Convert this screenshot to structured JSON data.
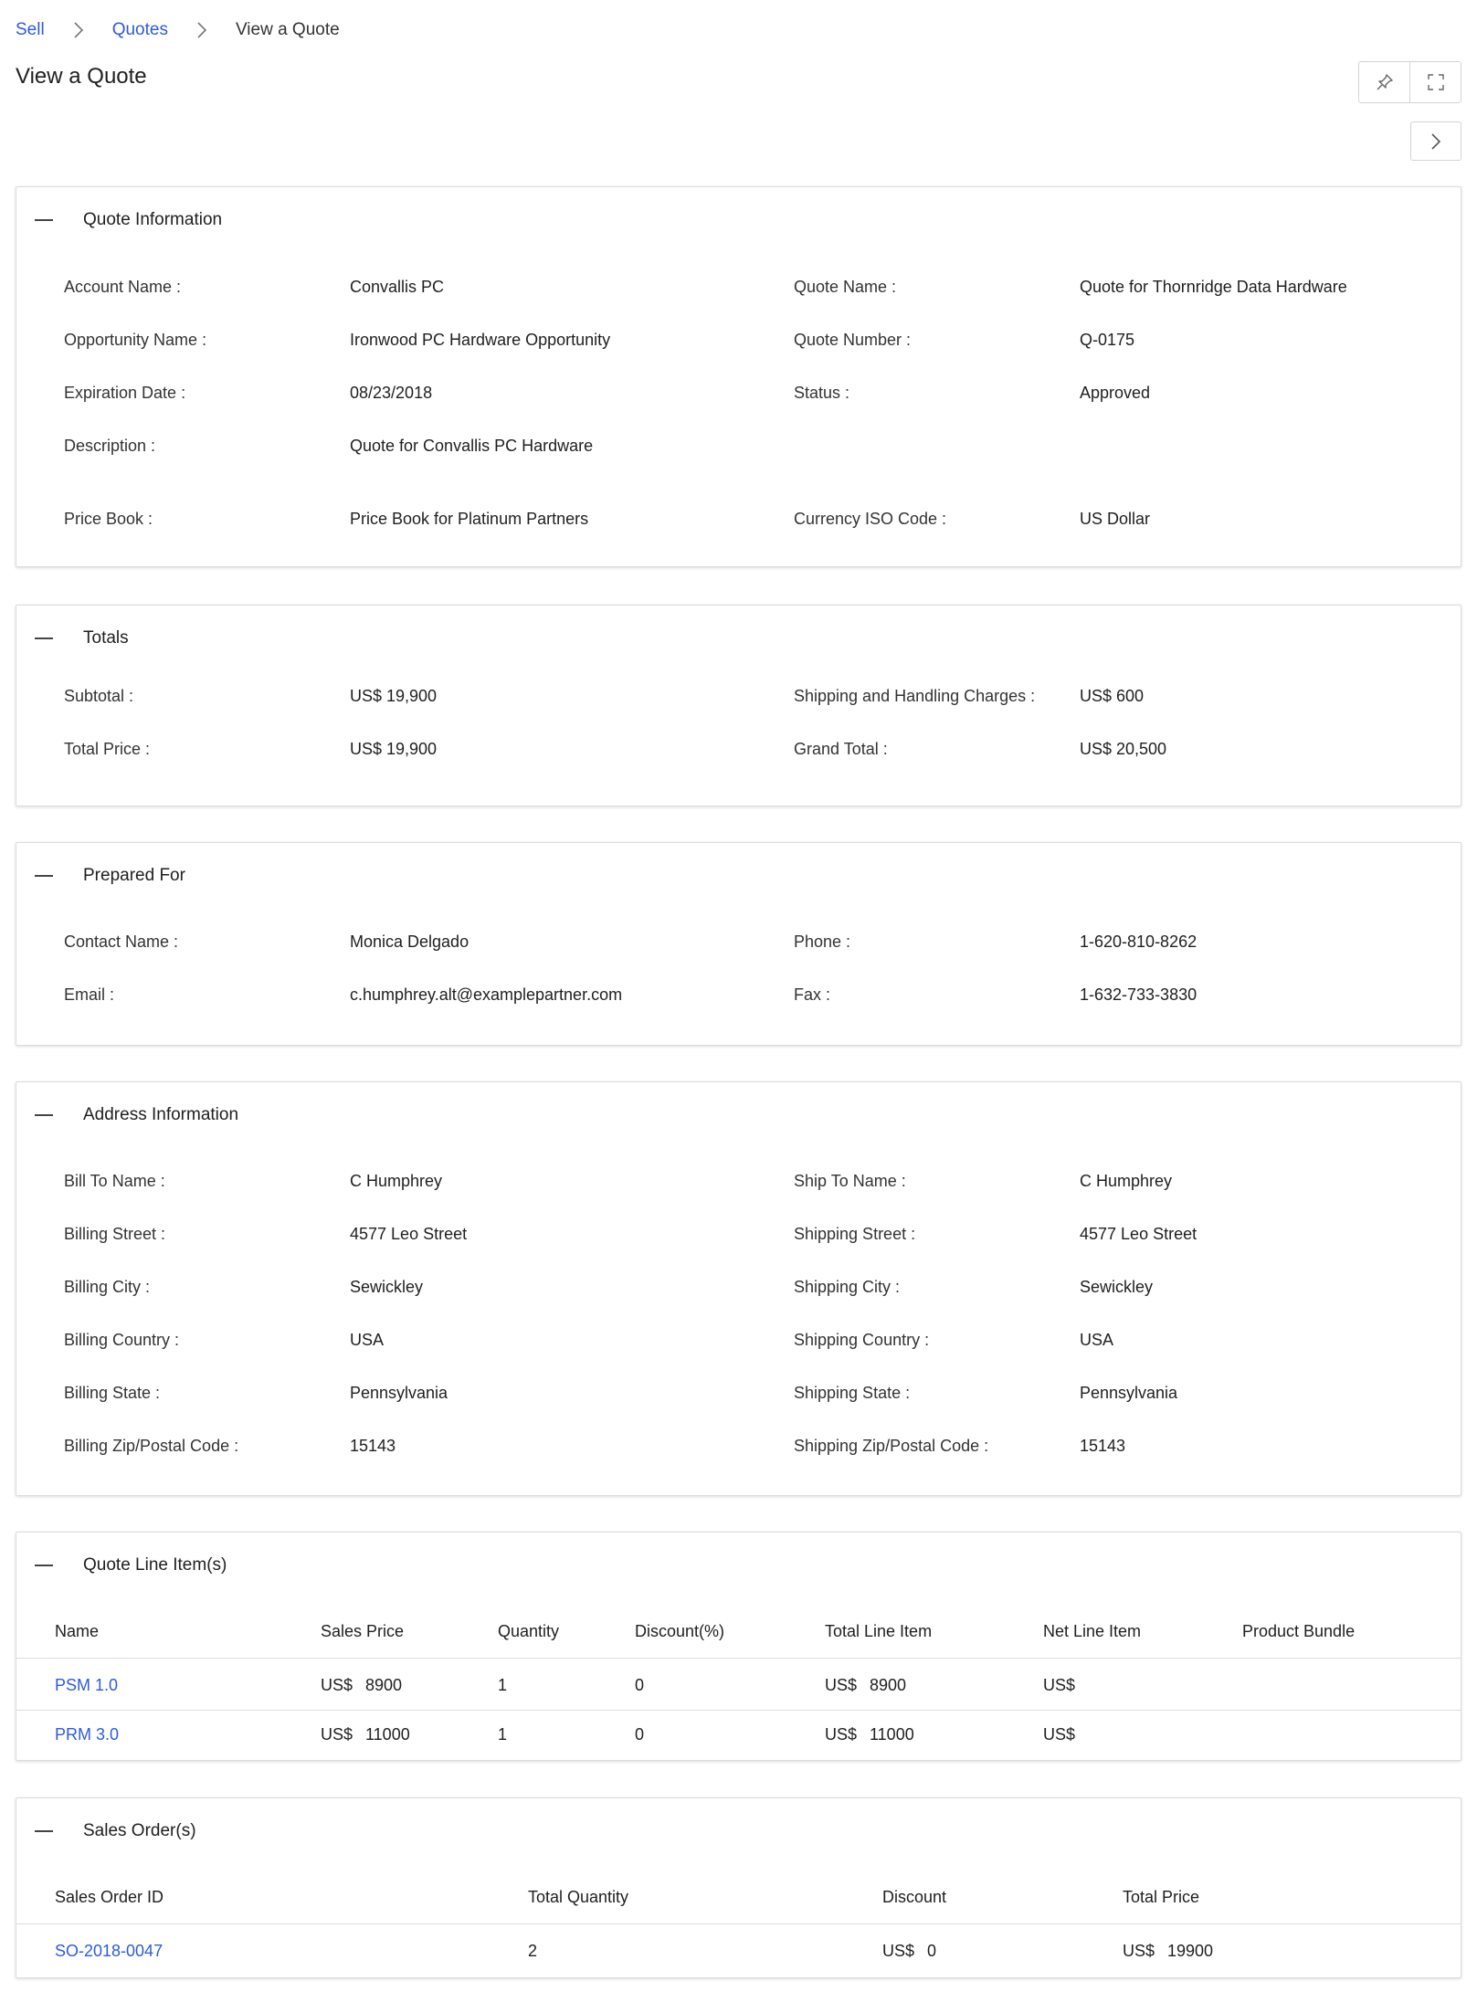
{
  "breadcrumb": {
    "sell": "Sell",
    "quotes": "Quotes",
    "current": "View a Quote"
  },
  "page_title": "View a Quote",
  "icons": {
    "pin": "pin-icon",
    "expand": "fullscreen-icon",
    "next": "chevron-right-icon",
    "separator": "chevron-right-icon",
    "collapse": "minus-icon"
  },
  "colors": {
    "link": "#2e5bd9"
  },
  "quote_info": {
    "title": "Quote Information",
    "account_name_label": "Account Name :",
    "account_name": "Convallis PC",
    "quote_name_label": "Quote Name :",
    "quote_name": "Quote for Thornridge Data Hardware",
    "opportunity_label": "Opportunity Name :",
    "opportunity": "Ironwood PC Hardware Opportunity",
    "quote_number_label": "Quote Number :",
    "quote_number": "Q-0175",
    "expiration_label": "Expiration Date :",
    "expiration": "08/23/2018",
    "status_label": "Status :",
    "status": "Approved",
    "description_label": "Description :",
    "description": "Quote for Convallis PC Hardware",
    "price_book_label": "Price Book :",
    "price_book": "Price Book for Platinum Partners",
    "currency_label": "Currency ISO Code :",
    "currency": "US Dollar"
  },
  "totals": {
    "title": "Totals",
    "subtotal_label": "Subtotal :",
    "subtotal": "US$ 19,900",
    "shipping_label": "Shipping and Handling Charges :",
    "shipping": "US$ 600",
    "total_price_label": "Total Price :",
    "total_price": "US$ 19,900",
    "grand_total_label": "Grand Total :",
    "grand_total": "US$ 20,500"
  },
  "prepared_for": {
    "title": "Prepared For",
    "contact_label": "Contact Name :",
    "contact": "Monica Delgado",
    "phone_label": "Phone :",
    "phone": "1-620-810-8262",
    "email_label": "Email :",
    "email": "c.humphrey.alt@examplepartner.com",
    "fax_label": "Fax :",
    "fax": "1-632-733-3830"
  },
  "address": {
    "title": "Address Information",
    "bill_name_label": "Bill To Name :",
    "bill_name": "C Humphrey",
    "ship_name_label": "Ship To Name :",
    "ship_name": "C Humphrey",
    "bill_street_label": "Billing Street :",
    "bill_street": "4577 Leo Street",
    "ship_street_label": "Shipping Street :",
    "ship_street": "4577 Leo Street",
    "bill_city_label": "Billing City :",
    "bill_city": "Sewickley",
    "ship_city_label": "Shipping City :",
    "ship_city": "Sewickley",
    "bill_country_label": "Billing Country :",
    "bill_country": "USA",
    "ship_country_label": "Shipping Country :",
    "ship_country": "USA",
    "bill_state_label": "Billing State :",
    "bill_state": "Pennsylvania",
    "ship_state_label": "Shipping State :",
    "ship_state": "Pennsylvania",
    "bill_zip_label": "Billing Zip/Postal Code :",
    "bill_zip": "15143",
    "ship_zip_label": "Shipping Zip/Postal Code :",
    "ship_zip": "15143"
  },
  "line_items": {
    "title": "Quote Line Item(s)",
    "headers": [
      "Name",
      "Sales Price",
      "Quantity",
      "Discount(%)",
      "Total Line Item",
      "Net Line Item",
      "Product Bundle"
    ],
    "rows": [
      {
        "name": "PSM 1.0",
        "sales_currency": "US$",
        "sales_price": "8900",
        "quantity": "1",
        "discount": "0",
        "total_currency": "US$",
        "total": "8900",
        "net_currency": "US$"
      },
      {
        "name": "PRM 3.0",
        "sales_currency": "US$",
        "sales_price": "11000",
        "quantity": "1",
        "discount": "0",
        "total_currency": "US$",
        "total": "11000",
        "net_currency": "US$"
      }
    ]
  },
  "sales_orders": {
    "title": "Sales Order(s)",
    "headers": [
      "Sales Order ID",
      "Total Quantity",
      "Discount",
      "Total Price"
    ],
    "rows": [
      {
        "id": "SO-2018-0047",
        "quantity": "2",
        "discount_currency": "US$",
        "discount": "0",
        "price_currency": "US$",
        "price": "19900"
      }
    ]
  }
}
